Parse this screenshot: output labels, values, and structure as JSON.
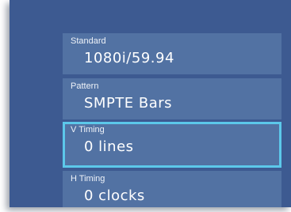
{
  "menu": {
    "items": [
      {
        "label": "Standard",
        "value": "1080i/59.94",
        "selected": false
      },
      {
        "label": "Pattern",
        "value": "SMPTE Bars",
        "selected": false
      },
      {
        "label": "V Timing",
        "value": "0 lines",
        "selected": true
      },
      {
        "label": "H Timing",
        "value": "0 clocks",
        "selected": false
      }
    ]
  },
  "colors": {
    "panel_background": "#3d5a91",
    "item_background": "#5272a3",
    "selection_border": "#5cc8ea",
    "text": "#ffffff"
  }
}
